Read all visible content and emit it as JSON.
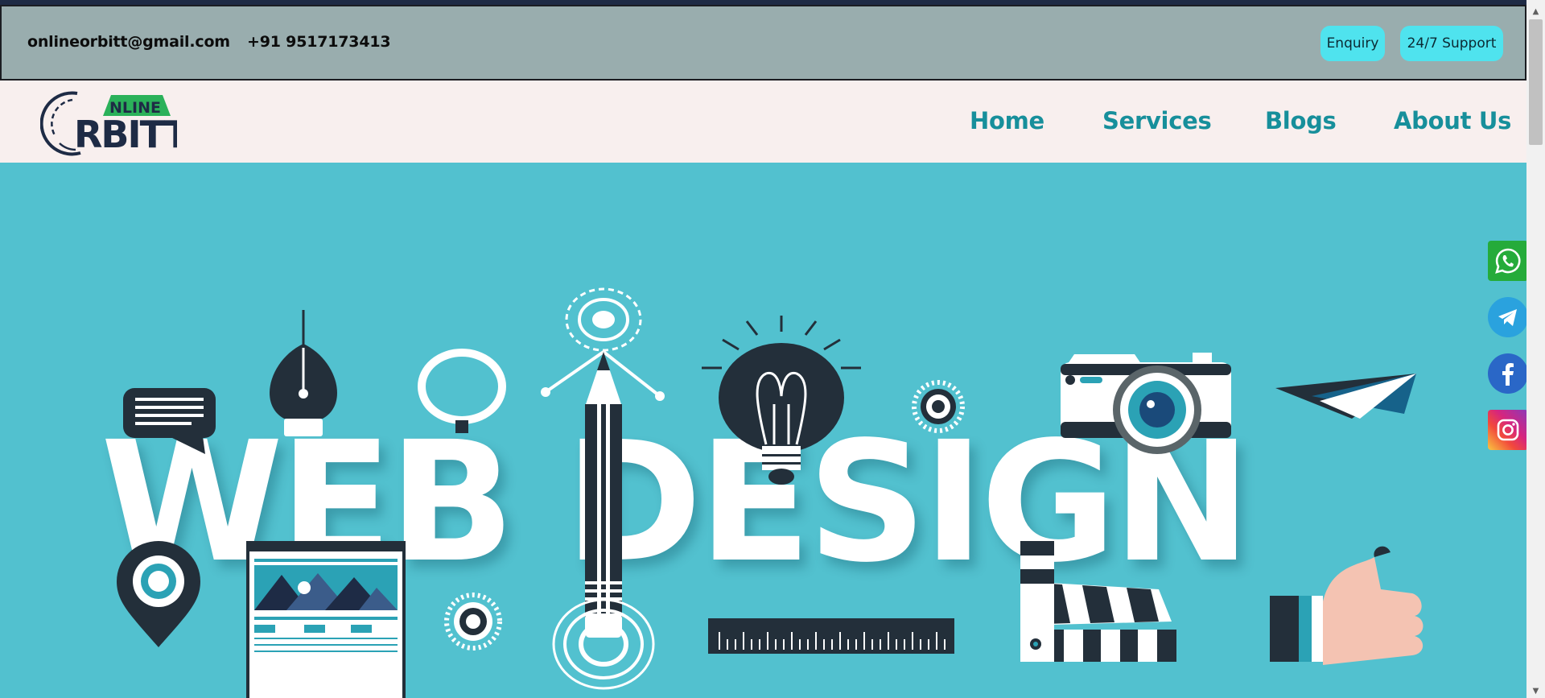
{
  "contact": {
    "email": "onlineorbitt@gmail.com",
    "phone": "+91 9517173413"
  },
  "top_buttons": {
    "enquiry": "Enquiry",
    "support": "24/7 Support"
  },
  "logo": {
    "line1": "NLINE",
    "line2": "RBITT"
  },
  "nav": {
    "home": "Home",
    "services": "Services",
    "blogs": "Blogs",
    "about": "About Us"
  },
  "hero": {
    "title": "WEB DESIGN",
    "background_color": "#52c1cf"
  },
  "social_icons": [
    "whatsapp-icon",
    "telegram-icon",
    "facebook-icon",
    "instagram-icon"
  ],
  "colors": {
    "accent": "#178f9b",
    "pill": "#4fe3ee",
    "contact_bar": "#99adae",
    "navbar": "#f8efee",
    "dark": "#232f3a"
  }
}
